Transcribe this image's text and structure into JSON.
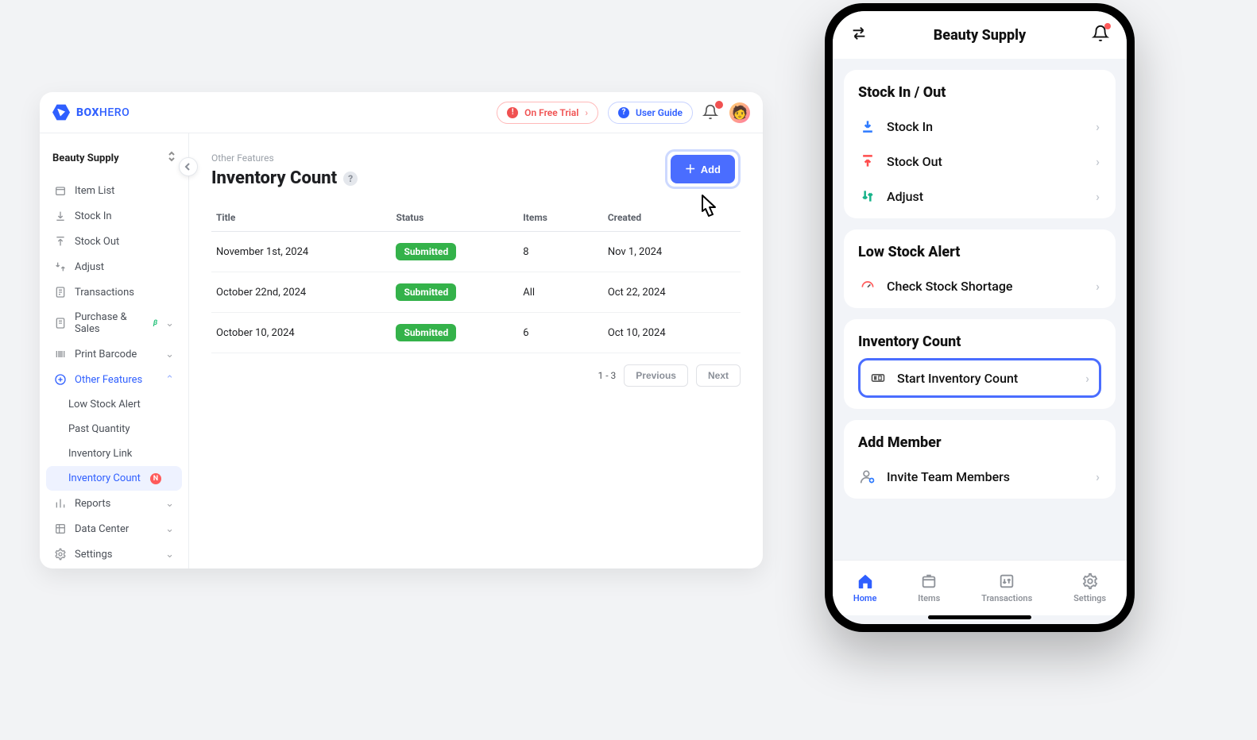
{
  "app": {
    "brand_box": "BOX",
    "brand_hero": "HERO",
    "team": "Beauty Supply"
  },
  "topbar": {
    "trial": "On Free Trial",
    "guide": "User Guide"
  },
  "sidebar": {
    "items": [
      {
        "label": "Item List"
      },
      {
        "label": "Stock In"
      },
      {
        "label": "Stock Out"
      },
      {
        "label": "Adjust"
      },
      {
        "label": "Transactions"
      },
      {
        "label": "Purchase & Sales"
      },
      {
        "label": "Print Barcode"
      },
      {
        "label": "Other Features"
      },
      {
        "label": "Low Stock Alert"
      },
      {
        "label": "Past Quantity"
      },
      {
        "label": "Inventory Link"
      },
      {
        "label": "Inventory Count"
      },
      {
        "label": "Reports"
      },
      {
        "label": "Data Center"
      },
      {
        "label": "Settings"
      }
    ],
    "beta": "β",
    "new": "N"
  },
  "page": {
    "crumb": "Other Features",
    "title": "Inventory Count",
    "add": "Add",
    "columns": {
      "title": "Title",
      "status": "Status",
      "items": "Items",
      "created": "Created"
    },
    "rows": [
      {
        "title": "November 1st, 2024",
        "status": "Submitted",
        "items": "8",
        "created": "Nov 1, 2024"
      },
      {
        "title": "October 22nd, 2024",
        "status": "Submitted",
        "items": "All",
        "created": "Oct 22, 2024"
      },
      {
        "title": "October 10, 2024",
        "status": "Submitted",
        "items": "6",
        "created": "Oct 10, 2024"
      }
    ],
    "pager": {
      "range": "1 - 3",
      "prev": "Previous",
      "next": "Next"
    }
  },
  "phone": {
    "title": "Beauty Supply",
    "sections": {
      "stock": {
        "heading": "Stock In / Out",
        "in": "Stock In",
        "out": "Stock Out",
        "adjust": "Adjust"
      },
      "low": {
        "heading": "Low Stock Alert",
        "check": "Check Stock Shortage"
      },
      "count": {
        "heading": "Inventory Count",
        "start": "Start Inventory Count"
      },
      "member": {
        "heading": "Add Member",
        "invite": "Invite Team Members"
      }
    },
    "tabs": {
      "home": "Home",
      "items": "Items",
      "tx": "Transactions",
      "settings": "Settings"
    }
  }
}
